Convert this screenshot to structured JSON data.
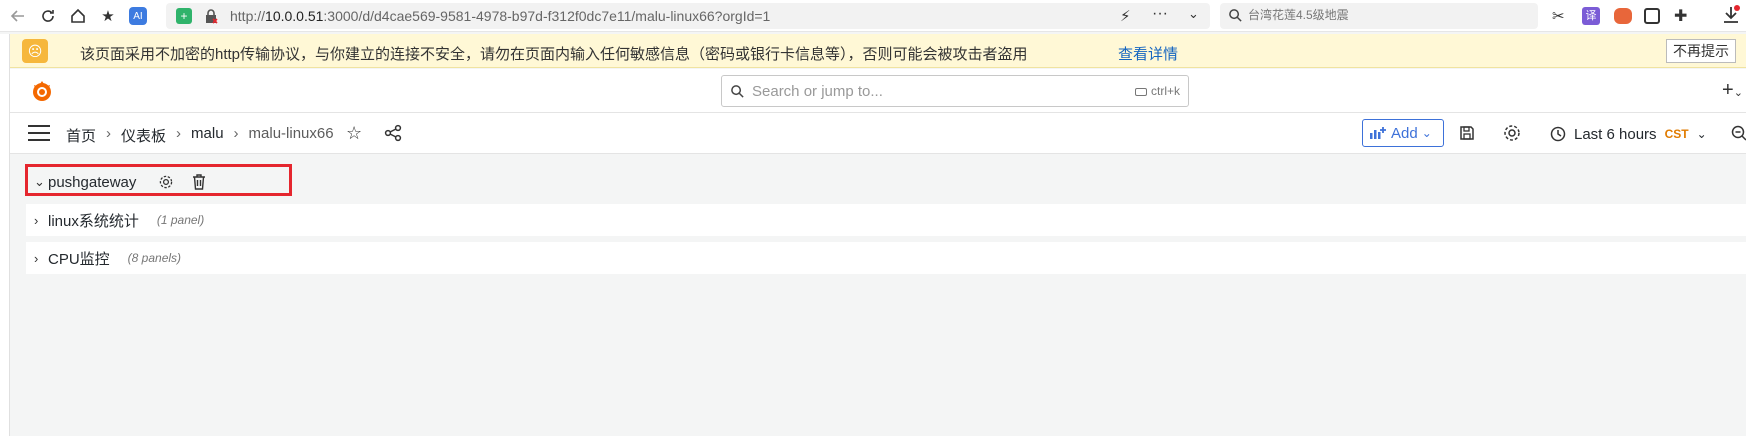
{
  "browser": {
    "url_prefix": "http://",
    "url_host": "10.0.0.51",
    "url_rest": ":3000/d/d4cae569-9581-4978-b97d-f312f0dc7e11/malu-linux66?orgId=1",
    "search_text": "台湾花莲4.5级地震",
    "icons": [
      "back-icon",
      "refresh-icon",
      "home-icon",
      "favorites-icon",
      "ai-icon",
      "shield-icon",
      "insecure-icon",
      "lightning-icon",
      "more-icon",
      "chevron-down-icon",
      "search-icon",
      "scissors-icon",
      "translate-icon",
      "game-icon",
      "reader-icon",
      "extensions-icon",
      "download-icon"
    ]
  },
  "warning": {
    "text": "该页面采用不加密的http传输协议，与你建立的连接不安全，请勿在页面内输入任何敏感信息（密码或银行卡信息等），否则可能会被攻击者盗用",
    "link": "查看详情",
    "dismiss": "不再提示"
  },
  "topbar": {
    "search_placeholder": "Search or jump to...",
    "search_shortcut": "ctrl+k",
    "plus": "+"
  },
  "nav": {
    "breadcrumbs": [
      "首页",
      "仪表板",
      "malu",
      "malu-linux66"
    ],
    "add_label": "Add",
    "time_range": "Last 6 hours",
    "timezone": "CST"
  },
  "rows": [
    {
      "title": "pushgateway",
      "count": ""
    },
    {
      "title": "linux系统统计",
      "count": "(1 panel)"
    },
    {
      "title": "CPU监控",
      "count": "(8 panels)"
    }
  ],
  "colors": {
    "highlight": "#e5262e",
    "accent": "#3d71d9",
    "timezone": "#e07b00",
    "warning_bg": "#fff8d6",
    "link": "#1565c0"
  }
}
